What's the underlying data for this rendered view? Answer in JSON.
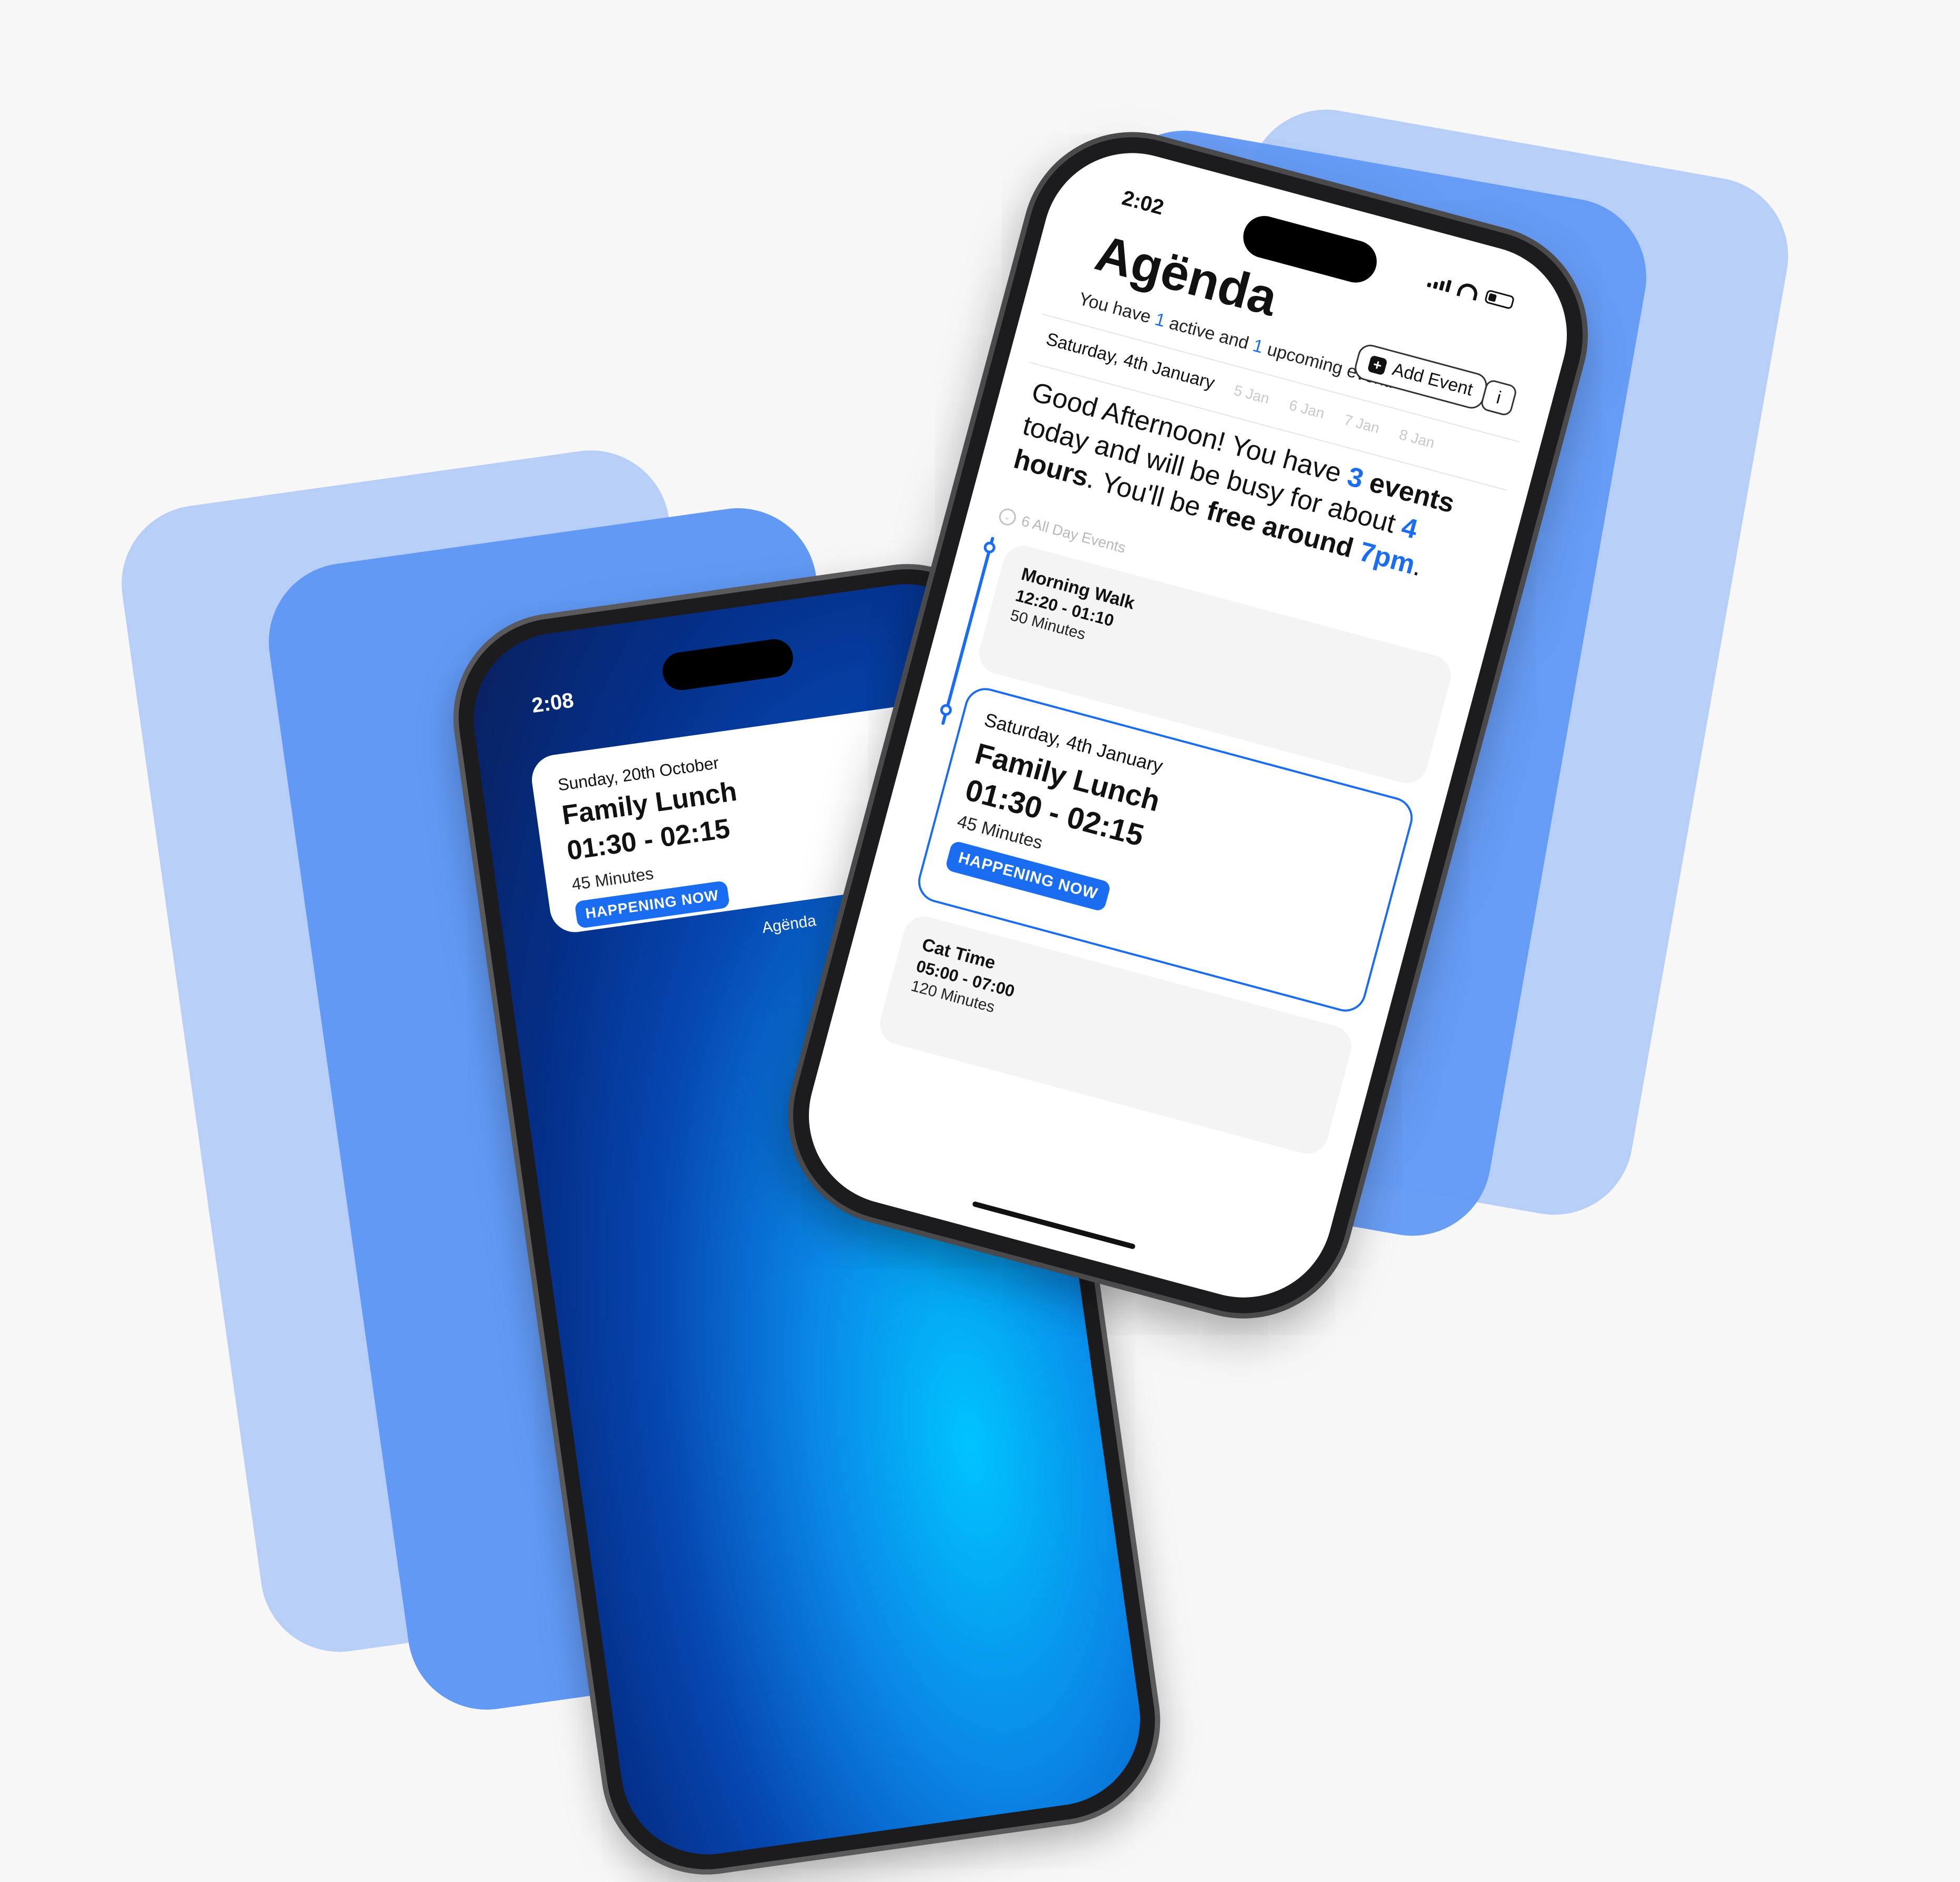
{
  "left_phone": {
    "time": "2:08",
    "widget": {
      "date": "Sunday, 20th October",
      "title": "Family Lunch",
      "time_range": "01:30 - 02:15",
      "duration": "45 Minutes",
      "badge": "HAPPENING NOW"
    },
    "caption": "Agënda"
  },
  "right_phone": {
    "time": "2:02",
    "app_title": "Agënda",
    "subtitle": {
      "p1": "You have ",
      "active_count": "1",
      "p2": " active and ",
      "upcoming_count": "1",
      "p3": " upcoming event."
    },
    "add_event_label": "Add Event",
    "info_label": "i",
    "date_strip": {
      "selected": "Saturday, 4th January",
      "others": [
        "5 Jan",
        "6 Jan",
        "7 Jan",
        "8 Jan"
      ]
    },
    "greeting": {
      "p1": "Good Afternoon! You have ",
      "events_num": "3",
      "events_word": " events",
      "p2": " today and will be busy for about ",
      "hours_num": "4",
      "hours_word": "hours",
      "p3": ". You'll be ",
      "free_label": "free around",
      "free_time": "7pm",
      "p4": "."
    },
    "all_day_label": "6 All Day Events",
    "events": [
      {
        "title": "Morning Walk",
        "time_range": "12:20 - 01:10",
        "duration": "50 Minutes"
      },
      {
        "date": "Saturday, 4th January",
        "title": "Family Lunch",
        "time_range": "01:30 - 02:15",
        "duration": "45 Minutes",
        "badge": "HAPPENING NOW"
      },
      {
        "title": "Cat Time",
        "time_range": "05:00 - 07:00",
        "duration": "120 Minutes"
      }
    ]
  },
  "colors": {
    "accent": "#1a6cf0",
    "card_light": "#b7cff6",
    "card_mid": "#6199f4",
    "background": "#f7f7f8"
  }
}
